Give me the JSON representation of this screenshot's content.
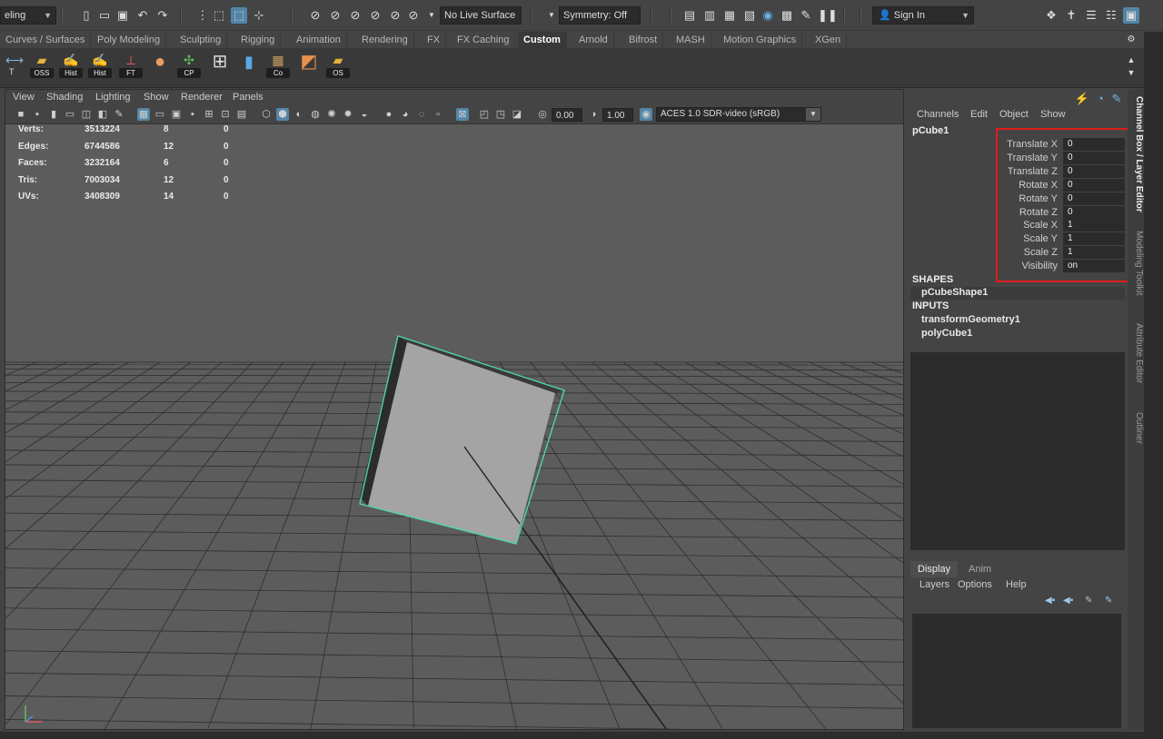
{
  "status_line": {
    "mode_menu": "eling",
    "live_surface": "No Live Surface",
    "symmetry": "Symmetry: Off",
    "sign_in": "Sign In"
  },
  "shelf_tabs": [
    "Curves / Surfaces",
    "Poly Modeling",
    "Sculpting",
    "Rigging",
    "Animation",
    "Rendering",
    "FX",
    "FX Caching",
    "Custom",
    "Arnold",
    "Bifrost",
    "MASH",
    "Motion Graphics",
    "XGen"
  ],
  "active_shelf_tab": "Custom",
  "shelf_buttons": [
    {
      "label": "T",
      "icon": "transform-icon"
    },
    {
      "label": "OSS",
      "icon": "folder-icon"
    },
    {
      "label": "Hist",
      "icon": "edit-icon"
    },
    {
      "label": "Hist",
      "icon": "edit-icon"
    },
    {
      "label": "FT",
      "icon": "axis-icon"
    },
    {
      "label": "",
      "icon": "sphere-icon"
    },
    {
      "label": "CP",
      "icon": "pivot-icon"
    },
    {
      "label": "",
      "icon": "grid-icon"
    },
    {
      "label": "",
      "icon": "bars-icon"
    },
    {
      "label": "Co",
      "icon": "texture-icon"
    },
    {
      "label": "",
      "icon": "cube-icon"
    },
    {
      "label": "OS",
      "icon": "folder-icon"
    }
  ],
  "viewport": {
    "menu": [
      "View",
      "Shading",
      "Lighting",
      "Show",
      "Renderer",
      "Panels"
    ],
    "exposure": "0.00",
    "gamma": "1.00",
    "color_space": "ACES 1.0 SDR-video (sRGB)",
    "hud": [
      {
        "label": "Verts:",
        "total": "3513224",
        "selected": "8",
        "component": "0"
      },
      {
        "label": "Edges:",
        "total": "6744586",
        "selected": "12",
        "component": "0"
      },
      {
        "label": "Faces:",
        "total": "3232164",
        "selected": "6",
        "component": "0"
      },
      {
        "label": "Tris:",
        "total": "7003034",
        "selected": "12",
        "component": "0"
      },
      {
        "label": "UVs:",
        "total": "3408309",
        "selected": "14",
        "component": "0"
      }
    ]
  },
  "channel_box": {
    "menu": [
      "Channels",
      "Edit",
      "Object",
      "Show"
    ],
    "object_name": "pCube1",
    "attributes": [
      {
        "name": "Translate X",
        "value": "0"
      },
      {
        "name": "Translate Y",
        "value": "0"
      },
      {
        "name": "Translate Z",
        "value": "0"
      },
      {
        "name": "Rotate X",
        "value": "0"
      },
      {
        "name": "Rotate Y",
        "value": "0"
      },
      {
        "name": "Rotate Z",
        "value": "0"
      },
      {
        "name": "Scale X",
        "value": "1"
      },
      {
        "name": "Scale Y",
        "value": "1"
      },
      {
        "name": "Scale Z",
        "value": "1"
      },
      {
        "name": "Visibility",
        "value": "on"
      }
    ],
    "shapes_header": "SHAPES",
    "shape": "pCubeShape1",
    "inputs_header": "INPUTS",
    "inputs": [
      "transformGeometry1",
      "polyCube1"
    ]
  },
  "layer_editor": {
    "tabs": [
      "Display",
      "Anim"
    ],
    "active_tab": "Display",
    "menu": [
      "Layers",
      "Options",
      "Help"
    ]
  },
  "side_tabs": [
    "Channel Box / Layer Editor",
    "Modeling Toolkit",
    "Attribute Editor",
    "Outliner"
  ],
  "colors": {
    "selection_outline": "#4fd6a4",
    "highlight_box": "#e01c1c",
    "active_blue": "#5285a6"
  }
}
